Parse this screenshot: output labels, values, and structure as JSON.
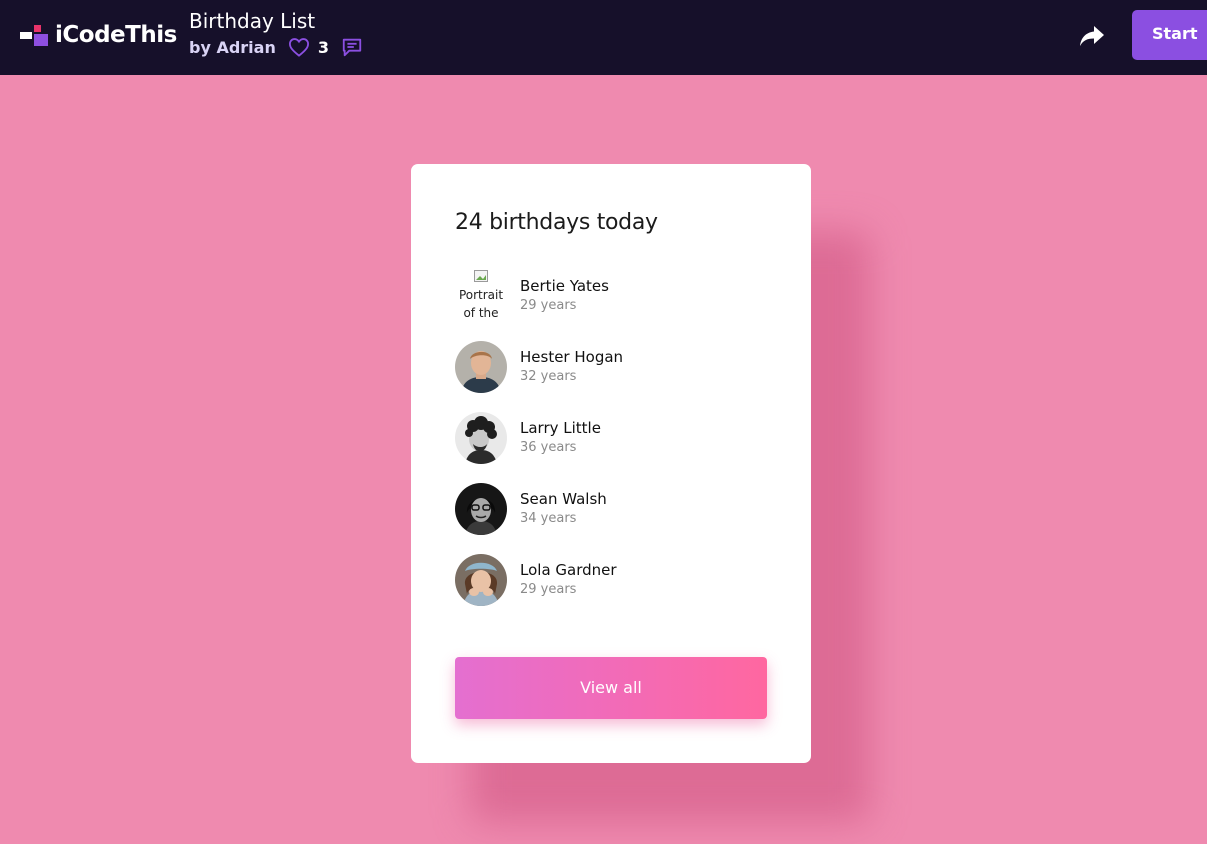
{
  "topbar": {
    "brand": "iCodeThis",
    "app_title": "Birthday List",
    "author": "by Adrian",
    "likes": "3",
    "start_label": "Start",
    "icons": [
      "heart-icon",
      "comment-icon",
      "share-icon"
    ]
  },
  "card": {
    "title": "24 birthdays today",
    "people": [
      {
        "name": "Bertie Yates",
        "age": "29 years",
        "avatar_alt": "Portrait of the"
      },
      {
        "name": "Hester Hogan",
        "age": "32 years"
      },
      {
        "name": "Larry Little",
        "age": "36 years"
      },
      {
        "name": "Sean Walsh",
        "age": "34 years"
      },
      {
        "name": "Lola Gardner",
        "age": "29 years"
      }
    ],
    "button_label": "View all"
  },
  "colors": {
    "background": "#ef8aaf",
    "topbar": "#16102a",
    "accent": "#8b4fe1",
    "button_gradient_start": "#e46fd0",
    "button_gradient_end": "#ff67a0"
  }
}
